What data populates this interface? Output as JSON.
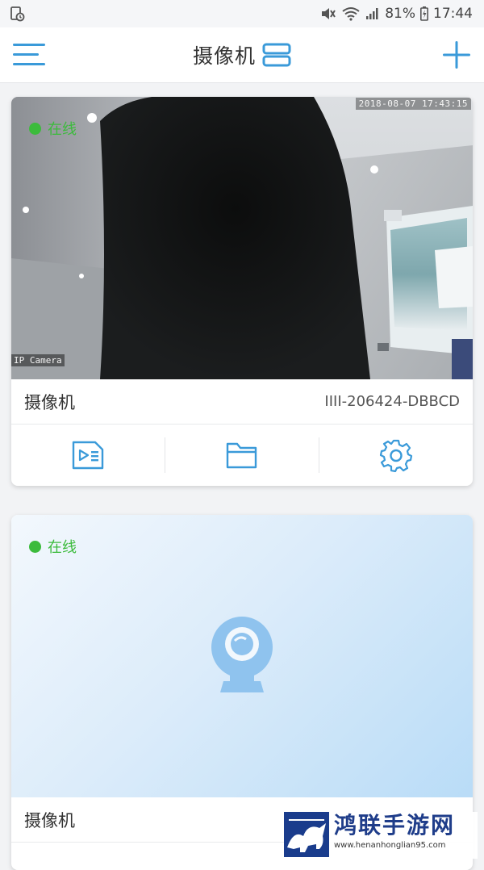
{
  "status_bar": {
    "battery": "81%",
    "time": "17:44"
  },
  "header": {
    "title": "摄像机"
  },
  "cameras": [
    {
      "status": "在线",
      "osd_timestamp": "2018-08-07 17:43:15",
      "osd_label": "IP Camera",
      "name": "摄像机",
      "device_id": "IIII-206424-DBBCD"
    },
    {
      "status": "在线",
      "name": "摄像机"
    }
  ],
  "actions": [
    "playback-icon",
    "folder-icon",
    "gear-icon"
  ],
  "colors": {
    "accent": "#3a9ad9",
    "online": "#3cbb3c"
  },
  "watermark": {
    "title": "鸿联手游网",
    "url": "www.henanhonglian95.com"
  }
}
